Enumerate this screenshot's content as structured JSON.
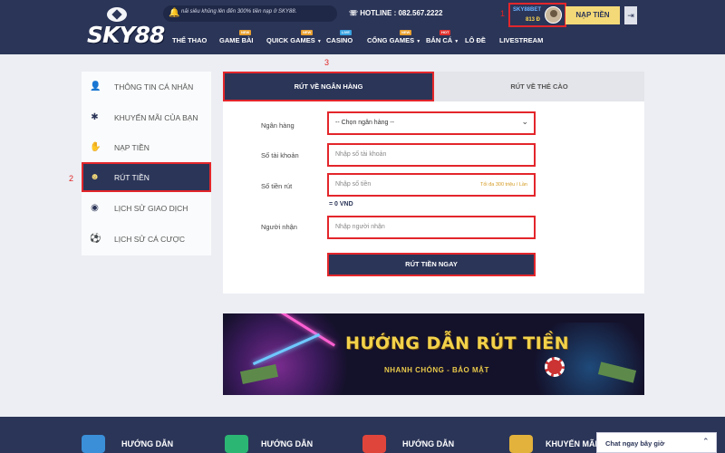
{
  "header": {
    "logo_text": "SKY88",
    "marquee": "nải siêu khủng lên đến 300% tiền nạp ở SKY88.",
    "hotline": "HOTLINE : 082.567.2222",
    "user": {
      "name": "SKY88BET",
      "balance": "813 Đ"
    },
    "deposit_label": "NẠP TIỀN",
    "logout_icon": "logout-icon",
    "annotation": "1",
    "nav": [
      {
        "label": "THỂ THAO",
        "badge": ""
      },
      {
        "label": "GAME BÀI",
        "badge": "NEW"
      },
      {
        "label": "QUICK GAMES",
        "badge": "NEW"
      },
      {
        "label": "CASINO",
        "badge": "LIVE"
      },
      {
        "label": "CỔNG GAMES",
        "badge": "NEW"
      },
      {
        "label": "BẮN CÁ",
        "badge": "HOT"
      },
      {
        "label": "LÔ ĐỀ",
        "badge": ""
      },
      {
        "label": "LIVESTREAM",
        "badge": ""
      }
    ]
  },
  "sidebar": {
    "annotation": "2",
    "items": [
      {
        "label": "THÔNG TIN CÁ NHÂN",
        "icon": "user-icon",
        "glyph": "👤"
      },
      {
        "label": "KHUYẾN MÃI CỦA BẠN",
        "icon": "gift-icon",
        "glyph": "✱"
      },
      {
        "label": "NẠP TIỀN",
        "icon": "deposit-icon",
        "glyph": "✋"
      },
      {
        "label": "RÚT TIỀN",
        "icon": "withdraw-icon",
        "glyph": "☻",
        "active": true
      },
      {
        "label": "LỊCH SỬ GIAO DỊCH",
        "icon": "history-icon",
        "glyph": "◉"
      },
      {
        "label": "LỊCH SỬ CÁ CƯỢC",
        "icon": "ball-icon",
        "glyph": "⚽"
      }
    ]
  },
  "form": {
    "annotation": "3",
    "tabs": [
      "RÚT VỀ NGÂN HÀNG",
      "RÚT VỀ THẺ CÀO"
    ],
    "bank_label": "Ngân hàng",
    "bank_value": "-- Chọn ngân hàng --",
    "account_label": "Số tài khoản",
    "account_placeholder": "Nhập số tài khoản",
    "amount_label": "Số tiền rút",
    "amount_placeholder": "Nhập số tiền",
    "amount_hint": "Tối đa 300 triệu / Lần",
    "conversion": "= 0 VND",
    "recipient_label": "Người nhận",
    "recipient_placeholder": "Nhập người nhận",
    "submit_label": "RÚT TIỀN NGAY"
  },
  "banner": {
    "title": "HƯỚNG DẪN RÚT TIỀN",
    "subtitle": "NHANH CHÓNG - BẢO MẬT"
  },
  "footer": {
    "items": [
      {
        "label": "HƯỚNG DẪN",
        "icon": "guide-icon",
        "color": "#3a8fd8"
      },
      {
        "label": "HƯỚNG DẪN",
        "icon": "dollar-icon",
        "color": "#2bb673"
      },
      {
        "label": "HƯỚNG DẪN",
        "icon": "return-icon",
        "color": "#e0453b"
      },
      {
        "label": "KHUYẾN MÃI",
        "icon": "tag-icon",
        "color": "#e3b23c"
      }
    ],
    "chat_label": "Chat ngay bây giờ"
  }
}
